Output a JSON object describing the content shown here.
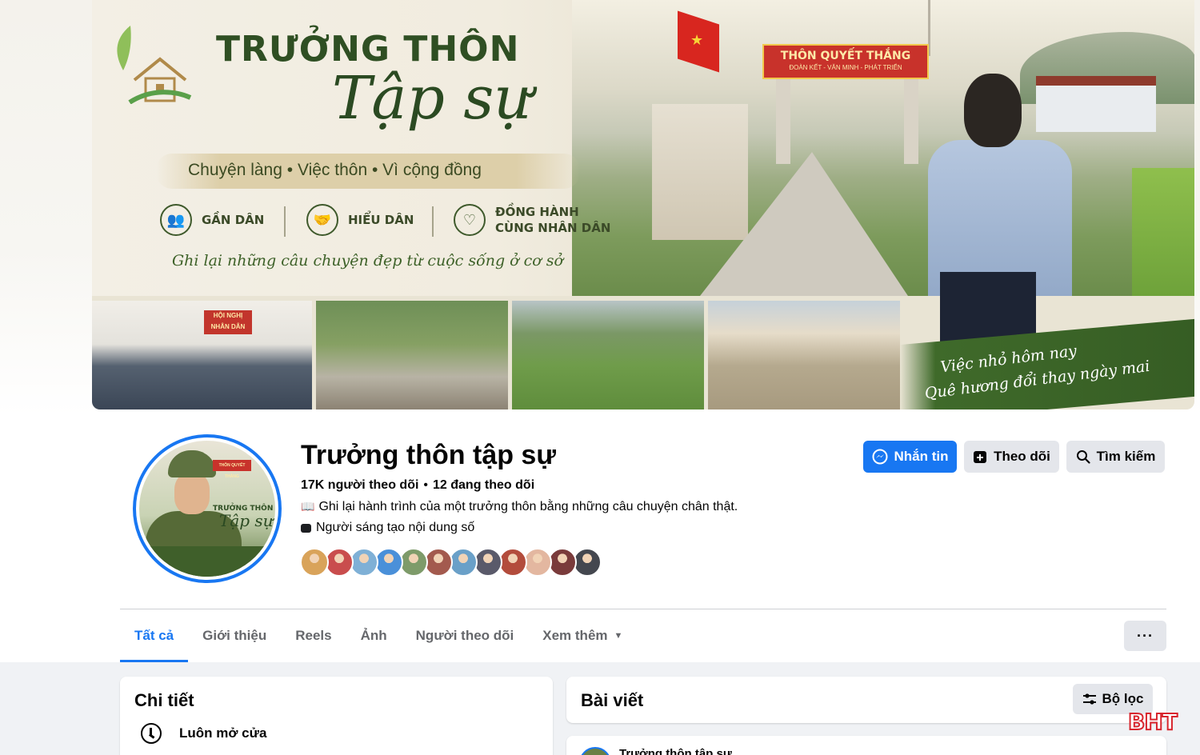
{
  "cover": {
    "title_line1": "TRƯỞNG THÔN",
    "title_line2": "Tập sự",
    "tagline": "Chuyện làng  •  Việc thôn  •  Vì cộng đồng",
    "pillars": [
      {
        "label": "GẦN DÂN",
        "icon": "people-group-icon"
      },
      {
        "label": "HIỂU DÂN",
        "icon": "handshake-icon"
      },
      {
        "label": "ĐỒNG HÀNH\nCÙNG NHÂN DÂN",
        "icon": "heart-hands-icon"
      }
    ],
    "slogan": "Ghi lại những câu chuyện đẹp từ cuộc sống ở cơ sở",
    "gate_sign": "THÔN QUYẾT THẮNG",
    "gate_sub": "ĐOÀN KẾT - VĂN MINH - PHÁT TRIỂN",
    "meeting_banner": "HỘI NGHỊ NHÂN DÂN",
    "quote_line1": "Việc nhỏ hôm nay",
    "quote_line2": "Quê hương đổi thay ngày mai"
  },
  "avatar": {
    "title1": "TRƯỞNG THÔN",
    "title2": "Tập sự",
    "sign": "THÔN QUYẾT THẮNG"
  },
  "profile": {
    "name": "Trưởng thôn tập sự",
    "followers": "17K người theo dõi",
    "following": "12 đang theo dõi",
    "bio": "Ghi lại hành trình của một trưởng thôn bằng những câu chuyện chân thật.",
    "bio_icon": "📖",
    "category": "Người sáng tạo nội dung số",
    "follower_avatar_colors": [
      "#d9a35a",
      "#c94d4d",
      "#7fb0d6",
      "#4a90d9",
      "#7e9b6a",
      "#a35a4e",
      "#6aa0c8",
      "#5a5a6a",
      "#b34c3c",
      "#e3b7a0",
      "#7a3b3b",
      "#44474f"
    ]
  },
  "actions": {
    "message": "Nhắn tin",
    "follow": "Theo dõi",
    "search": "Tìm kiếm"
  },
  "tabs": [
    {
      "label": "Tất cả",
      "active": true
    },
    {
      "label": "Giới thiệu",
      "active": false
    },
    {
      "label": "Reels",
      "active": false
    },
    {
      "label": "Ảnh",
      "active": false
    },
    {
      "label": "Người theo dõi",
      "active": false
    },
    {
      "label": "Xem thêm",
      "active": false
    }
  ],
  "more_menu": "···",
  "details": {
    "title": "Chi tiết",
    "hours": "Luôn mở cửa"
  },
  "posts": {
    "title": "Bài viết",
    "filter": "Bộ lọc",
    "first_post_author": "Trưởng thôn tập sự"
  },
  "watermark": "BHT",
  "colors": {
    "accent": "#1877f2",
    "button_grey": "#e4e6eb",
    "cover_green": "#2f4f23"
  }
}
